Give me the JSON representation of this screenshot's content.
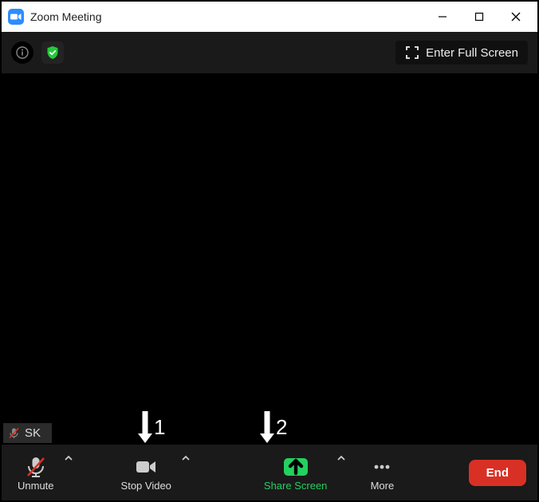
{
  "window": {
    "title": "Zoom Meeting"
  },
  "topbar": {
    "fullscreen_label": "Enter Full Screen"
  },
  "participant": {
    "initials": "SK"
  },
  "annotations": {
    "arrow1": "1",
    "arrow2": "2"
  },
  "toolbar": {
    "unmute": "Unmute",
    "stop_video": "Stop Video",
    "share_screen": "Share Screen",
    "more": "More",
    "end": "End"
  }
}
